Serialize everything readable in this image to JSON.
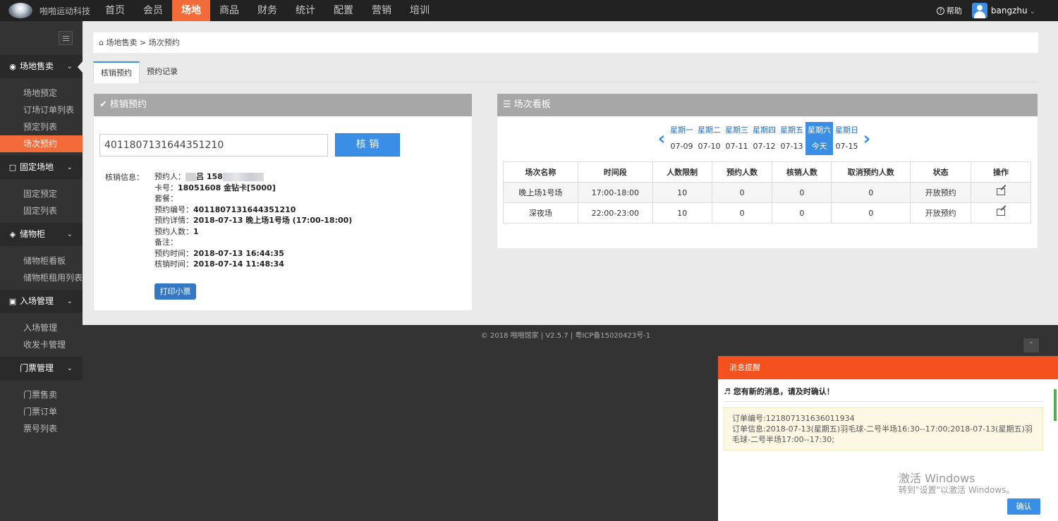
{
  "brand": {
    "name": "啪啪运动科技"
  },
  "nav": {
    "items": [
      "首页",
      "会员",
      "场地",
      "商品",
      "财务",
      "统计",
      "配置",
      "营销",
      "培训"
    ],
    "active_index": 2
  },
  "topright": {
    "help": "帮助",
    "username": "bangzhu"
  },
  "sidebar": {
    "groups": [
      {
        "label": "场地售卖",
        "items": [
          "场地预定",
          "订场订单列表",
          "预定列表",
          "场次预约"
        ]
      },
      {
        "label": "固定场地",
        "items": [
          "固定预定",
          "固定列表"
        ]
      },
      {
        "label": "储物柜",
        "items": [
          "储物柜看板",
          "储物柜租用列表"
        ]
      },
      {
        "label": "入场管理",
        "items": [
          "入场管理",
          "收发卡管理"
        ]
      },
      {
        "label": "门票管理",
        "items": [
          "门票售卖",
          "门票订单",
          "票号列表"
        ]
      }
    ],
    "active_item": "场次预约"
  },
  "breadcrumb": {
    "parent": "场地售卖",
    "sep": ">",
    "current": "场次预约"
  },
  "tabs": [
    "核销预约",
    "预约记录"
  ],
  "verify": {
    "title": "核销预约",
    "code_value": "4011807131644351210",
    "button": "核 销",
    "info_label": "核销信息：",
    "lines": {
      "booker_label": "预约人：",
      "booker_suffix": "吕 158",
      "card_label": "卡号：",
      "card_value": "18051608 金钻卡[5000]",
      "package_label": "套餐：",
      "package_value": "",
      "number_label": "预约编号：",
      "number_value": "4011807131644351210",
      "detail_label": "预约详情：",
      "detail_value": "2018-07-13 晚上场1号场 (17:00-18:00)",
      "count_label": "预约人数：",
      "count_value": "1",
      "note_label": "备注：",
      "note_value": "",
      "time_label": "预约时间：",
      "time_value": "2018-07-13 16:44:35",
      "verify_time_label": "核销时间：",
      "verify_time_value": "2018-07-14 11:48:34"
    },
    "print_button": "打印小票"
  },
  "board": {
    "title": "场次看板",
    "days": [
      {
        "name": "星期一",
        "date": "07-09"
      },
      {
        "name": "星期二",
        "date": "07-10"
      },
      {
        "name": "星期三",
        "date": "07-11"
      },
      {
        "name": "星期四",
        "date": "07-12"
      },
      {
        "name": "星期五",
        "date": "07-13"
      },
      {
        "name": "星期六",
        "date": "今天"
      },
      {
        "name": "星期日",
        "date": "07-15"
      }
    ],
    "active_day": 5,
    "columns": [
      "场次名称",
      "时间段",
      "人数限制",
      "预约人数",
      "核销人数",
      "取消预约人数",
      "状态",
      "操作"
    ],
    "rows": [
      [
        "晚上场1号场",
        "17:00-18:00",
        "10",
        "0",
        "0",
        "0",
        "开放预约"
      ],
      [
        "深夜场",
        "22:00-23:00",
        "10",
        "0",
        "0",
        "0",
        "开放预约"
      ]
    ]
  },
  "footer": {
    "copyright": "© 2018 啪啪馆家 | V2.5.7 | 粤ICP备15020423号-1"
  },
  "message": {
    "title": "消息提醒",
    "subtitle": "您有新的消息，请及时确认！",
    "order_no": "订单编号:121807131636011934",
    "order_info": "订单信息:2018-07-13(星期五)羽毛球-二号半场16:30--17:00;2018-07-13(星期五)羽毛球-二号半场17:00--17:30;",
    "confirm": "确认"
  },
  "watermark": {
    "line1": "激活 Windows",
    "line2": "转到\"设置\"以激活 Windows。"
  }
}
